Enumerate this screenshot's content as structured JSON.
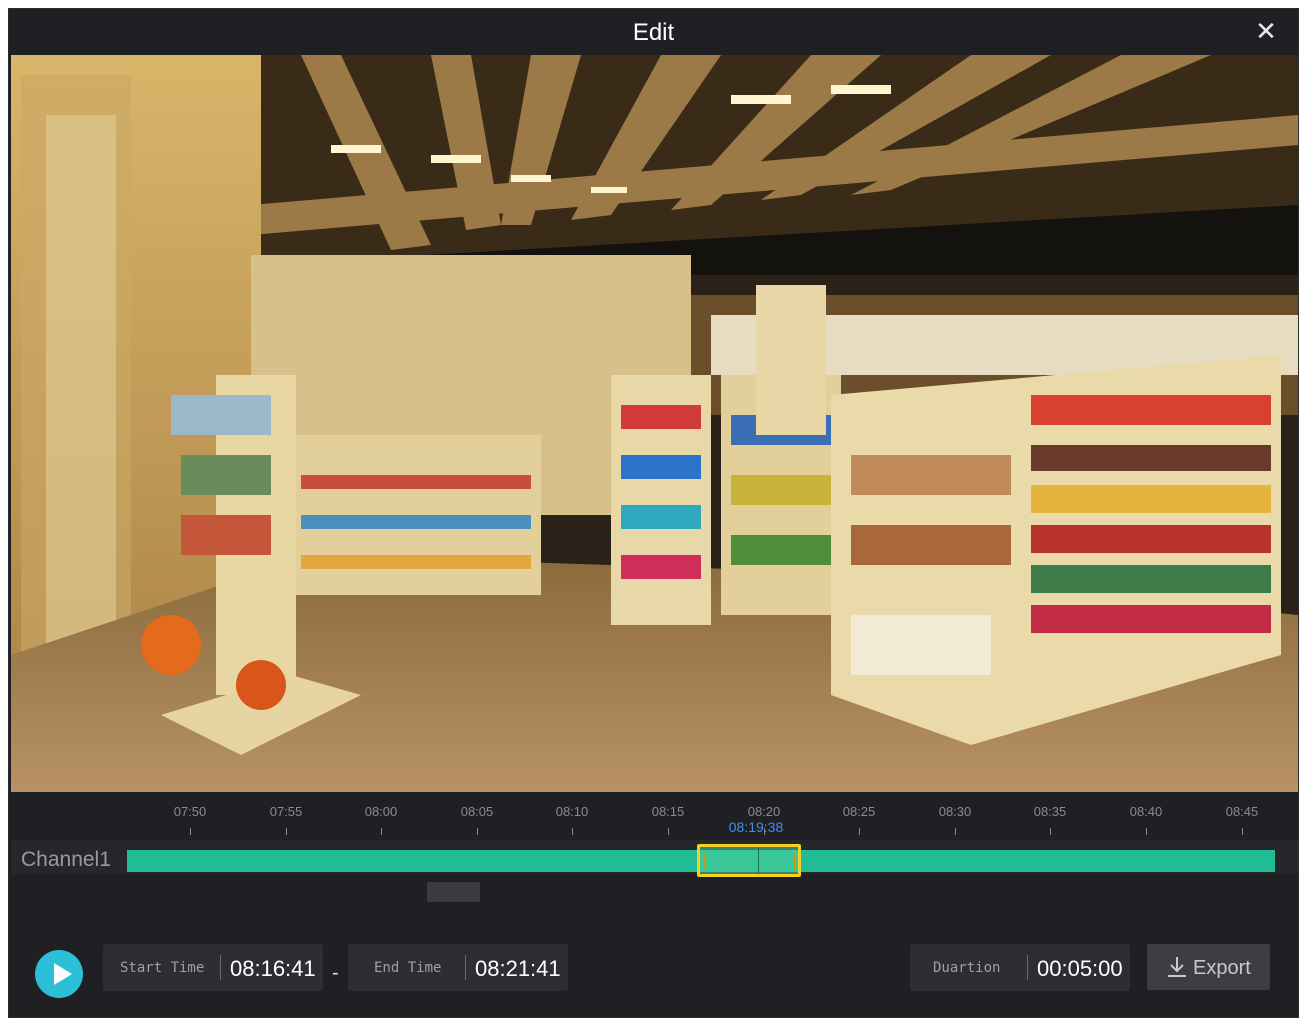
{
  "window": {
    "title": "Edit"
  },
  "timeline": {
    "ticks": [
      "07:50",
      "07:55",
      "08:00",
      "08:05",
      "08:10",
      "08:15",
      "08:20",
      "08:25",
      "08:30",
      "08:35",
      "08:40",
      "08:45"
    ],
    "cursor_time": "08:19:38",
    "channel_label": "Channel1",
    "colors": {
      "track": "#1fbc95",
      "selection_border": "#f3d023",
      "cursor_text": "#3d8ff0"
    }
  },
  "controls": {
    "start_time_label": "Start Time",
    "start_time_value": "08:16:41",
    "separator": "-",
    "end_time_label": "End Time",
    "end_time_value": "08:21:41",
    "duration_label": "Duartion",
    "duration_value": "00:05:00",
    "export_label": "Export",
    "play_icon": "play-icon",
    "accent_color": "#2bbfd8"
  }
}
